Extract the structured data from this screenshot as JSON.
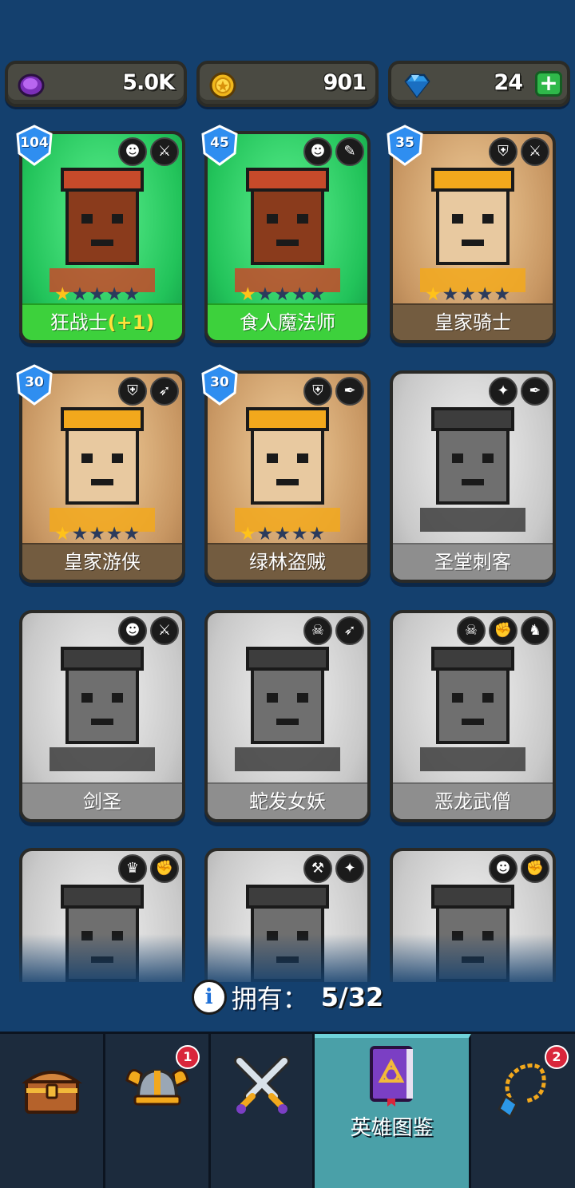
{
  "currency": {
    "elixir": {
      "icon": "purple-coin-icon",
      "value": "5.0K"
    },
    "gold": {
      "icon": "gold-coin-icon",
      "value": "901"
    },
    "gems": {
      "icon": "diamond-icon",
      "value": "24",
      "plus": "+"
    }
  },
  "heroes": [
    {
      "name": "狂战士",
      "bonus": "(+1)",
      "level": "104",
      "stars": 1,
      "style": "green",
      "roles": [
        "ogre-class-icon",
        "sword-icon"
      ]
    },
    {
      "name": "食人魔法师",
      "bonus": "",
      "level": "45",
      "stars": 1,
      "style": "green",
      "roles": [
        "ogre-class-icon",
        "staff-icon"
      ]
    },
    {
      "name": "皇家骑士",
      "bonus": "",
      "level": "35",
      "stars": 1,
      "style": "brown",
      "roles": [
        "helmet-class-icon",
        "sword-icon"
      ]
    },
    {
      "name": "皇家游侠",
      "bonus": "",
      "level": "30",
      "stars": 1,
      "style": "brown",
      "roles": [
        "helmet-class-icon",
        "bow-icon"
      ]
    },
    {
      "name": "绿林盗贼",
      "bonus": "",
      "level": "30",
      "stars": 1,
      "style": "brown",
      "roles": [
        "helmet-class-icon",
        "dagger-icon"
      ]
    },
    {
      "name": "圣堂刺客",
      "bonus": "",
      "level": "",
      "stars": 0,
      "style": "gray",
      "roles": [
        "wings-class-icon",
        "dagger-icon"
      ]
    },
    {
      "name": "剑圣",
      "bonus": "",
      "level": "",
      "stars": 0,
      "style": "gray",
      "roles": [
        "ogre-class-icon",
        "sword-icon"
      ]
    },
    {
      "name": "蛇发女妖",
      "bonus": "",
      "level": "",
      "stars": 0,
      "style": "gray",
      "roles": [
        "demon-class-icon",
        "bow-icon"
      ]
    },
    {
      "name": "恶龙武僧",
      "bonus": "",
      "level": "",
      "stars": 0,
      "style": "gray",
      "roles": [
        "demon-class-icon",
        "fist-icon",
        "dragon-icon"
      ]
    },
    {
      "name": "",
      "bonus": "",
      "level": "",
      "stars": 0,
      "style": "gray",
      "roles": [
        "elf-class-icon",
        "fist-icon"
      ]
    },
    {
      "name": "",
      "bonus": "",
      "level": "",
      "stars": 0,
      "style": "gray",
      "roles": [
        "hammer-icon",
        "wings-class-icon"
      ]
    },
    {
      "name": "",
      "bonus": "",
      "level": "",
      "stars": 0,
      "style": "gray",
      "roles": [
        "ogre-class-icon",
        "fist-icon"
      ]
    }
  ],
  "owned": {
    "label": "拥有：",
    "value": "5/32",
    "icon": "info-icon"
  },
  "nav": {
    "tabs": [
      {
        "icon": "treasure-chest-icon",
        "label": "",
        "badge": ""
      },
      {
        "icon": "viking-helmet-icon",
        "label": "",
        "badge": "1"
      },
      {
        "icon": "crossed-swords-icon",
        "label": "",
        "badge": ""
      },
      {
        "icon": "hero-book-icon",
        "label": "英雄图鉴",
        "badge": "",
        "active": true
      },
      {
        "icon": "amulet-icon",
        "label": "",
        "badge": "2"
      }
    ]
  }
}
